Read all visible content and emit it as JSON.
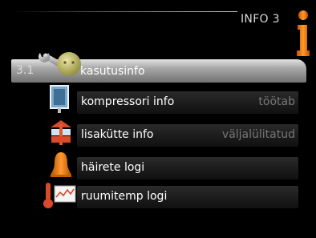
{
  "header": {
    "menu_title": "INFO 3"
  },
  "menu": {
    "items": [
      {
        "number": "3.1",
        "label": "kasutusinfo",
        "value": "",
        "icon": "person-wrench-icon",
        "selected": true
      },
      {
        "number": "",
        "label": "kompressori info",
        "value": "töötab",
        "icon": "compressor-icon",
        "selected": false
      },
      {
        "number": "",
        "label": "lisakütte info",
        "value": "väljalülitatud",
        "icon": "additional-heat-icon",
        "selected": false
      },
      {
        "number": "",
        "label": "häirete logi",
        "value": "",
        "icon": "alarm-bell-icon",
        "selected": false
      },
      {
        "number": "",
        "label": "ruumitemp logi",
        "value": "",
        "icon": "temperature-log-icon",
        "selected": false
      }
    ]
  },
  "colors": {
    "background": "#000000",
    "accent": "#f07800",
    "selected_bar": "#a5a5a5",
    "value_text": "#777777"
  }
}
